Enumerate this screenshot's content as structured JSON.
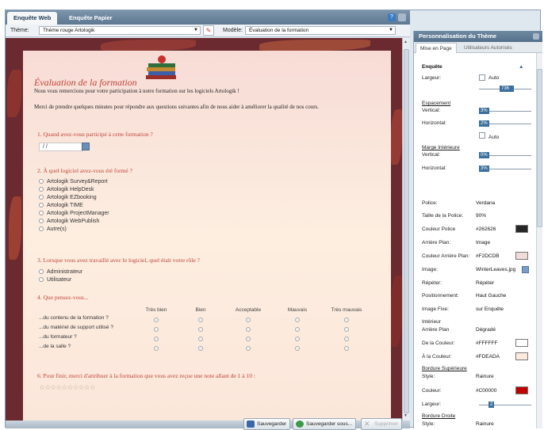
{
  "tabs": {
    "web": "Enquête Web",
    "paper": "Enquête Papier"
  },
  "themebar": {
    "theme_label": "Thème:",
    "theme_value": "Thème rouge Artologik",
    "model_label": "Modèle:",
    "model_value": "Évaluation de la formation"
  },
  "survey": {
    "title": "Évaluation de la formation",
    "intro1": "Nous vous remercions pour votre participation à notre formation sur les logiciels Artologik !",
    "intro2": "Merci de prendre quelques minutes pour répondre aux questions suivantes afin de nous aider à améliorer la qualité de nos cours.",
    "q1": "1. Quand avez-vous participé à cette formation ?",
    "date_placeholder": "/ /",
    "q2": "2. À quel logiciel avez-vous été formé ?",
    "q2_options": [
      "Artologik Survey&Report",
      "Artologik HelpDesk",
      "Artologik EZbooking",
      "Artologik TIME",
      "Artologik ProjectManager",
      "Artologik WebPublish",
      "Autre(s)"
    ],
    "q3": "3. Lorsque vous avez travaillé avec le logiciel, quel était votre rôle ?",
    "q3_options": [
      "Administrateur",
      "Utilisateur"
    ],
    "q4": "4. Que pensez-vous...",
    "q4_columns": [
      "Très bien",
      "Bien",
      "Acceptable",
      "Mauvais",
      "Très mauvais"
    ],
    "q4_rows": [
      "...du contenu de la formation ?",
      "...du matériel de support utilisé ?",
      "...du formateur ?",
      "...de la salle ?"
    ],
    "q6": "6. Pour finir, merci d'attribuer à la formation que vous avez reçue une note allant de 1 à 10 :",
    "rating_max": 10,
    "rating_value": 0
  },
  "bottom": {
    "save": "Sauvegarder",
    "save_as": "Sauvegarder sous...",
    "delete": "Supprimer"
  },
  "side": {
    "title": "Personnalisation du Thème",
    "tab_layout": "Mise en Page",
    "tab_users": "Utilisateurs Autorisés",
    "section_enquete": "Enquête",
    "largeur_label": "Largeur:",
    "auto_label": "Auto",
    "largeur_value": "736",
    "espacement": "Espacement",
    "vertical_label": "Vertical:",
    "horizontal_label": "Horizontal:",
    "esp_vertical": "3%",
    "esp_horizontal": "2%",
    "marge": "Marge Intérieure",
    "marge_vertical": "0%",
    "marge_horizontal": "3%",
    "police_label": "Police:",
    "police_value": "Verdana",
    "taille_label": "Taille de la Police:",
    "taille_value": "90%",
    "couleur_police_label": "Couleur Police",
    "couleur_police_value": "#262626",
    "arriere_plan_label": "Arrière Plan:",
    "arriere_plan_value": "Image",
    "couleur_ap_label": "Couleur Arrière Plan:",
    "couleur_ap_value": "#F2DCDB",
    "image_label": "Image:",
    "image_value": "WinterLeaves.jpg",
    "repeter_label": "Répéter:",
    "repeter_value": "Répéter",
    "position_label": "Positionnement:",
    "position_value": "Haut Gauche",
    "image_fixe_label": "Image Fixe:",
    "image_fixe_value": "sur Enquête",
    "interieur_label": "Intérieur",
    "ap_label": "Arrière Plan",
    "ap_value": "Dégradé",
    "de_couleur_label": "De la Couleur:",
    "de_couleur_value": "#FFFFFF",
    "a_couleur_label": "À la Couleur:",
    "a_couleur_value": "#FDEADA",
    "bordure_sup": "Bordure Supérieure",
    "style_label": "Style:",
    "style_value": "Rainure",
    "couleur_label": "Couleur:",
    "couleur_value": "#C00000",
    "largeur2_label": "Largeur:",
    "largeur2_value": "2",
    "bordure_droite": "Bordure Droite",
    "style2_value": "Rainure"
  },
  "colors": {
    "accent": "#c2443a",
    "swatch_font": "#262626",
    "swatch_bg": "#F2DCDB",
    "swatch_from": "#FFFFFF",
    "swatch_to": "#FDEADA",
    "swatch_border": "#C00000"
  }
}
